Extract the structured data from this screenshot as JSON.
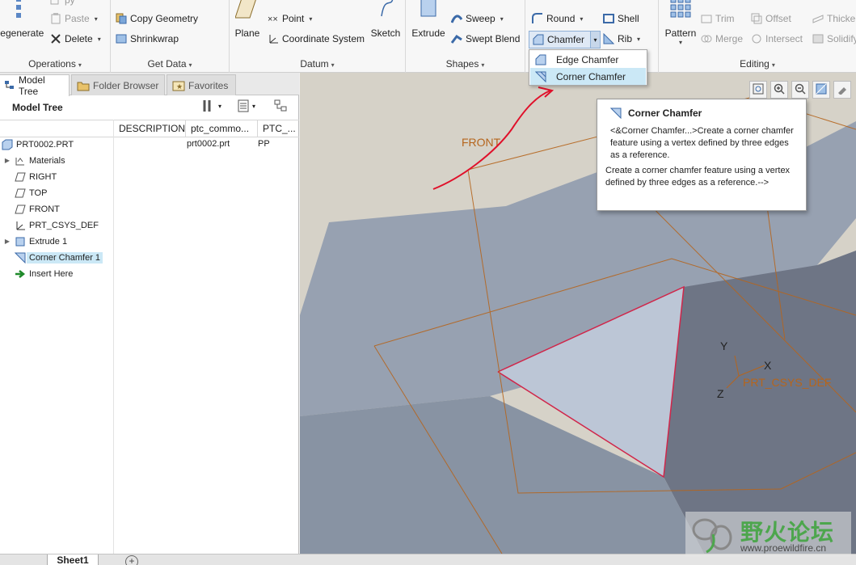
{
  "ribbon": {
    "operations": {
      "regenerate": "Regenerate",
      "copy_partial": "py",
      "paste": "Paste",
      "delete": "Delete",
      "label": "Operations"
    },
    "get_data": {
      "copy_geometry": "Copy Geometry",
      "shrinkwrap": "Shrinkwrap",
      "label": "Get Data"
    },
    "datum": {
      "plane": "Plane",
      "point": "Point",
      "coordinate_system": "Coordinate System",
      "sketch": "Sketch",
      "label": "Datum"
    },
    "shapes": {
      "extrude": "Extrude",
      "sweep": "Sweep",
      "swept_blend": "Swept Blend",
      "label": "Shapes"
    },
    "engineering": {
      "round": "Round",
      "shell": "Shell",
      "chamfer": "Chamfer",
      "rib": "Rib"
    },
    "editing": {
      "pattern": "Pattern",
      "trim": "Trim",
      "offset": "Offset",
      "thicken": "Thicke",
      "merge": "Merge",
      "intersect": "Intersect",
      "solidify": "Solidify",
      "label": "Editing"
    },
    "dropdown_indicator": "▾"
  },
  "chamfer_menu": {
    "items": [
      {
        "label": "Edge Chamfer"
      },
      {
        "label": "Corner Chamfer"
      }
    ]
  },
  "left_panel": {
    "tabs": [
      {
        "label": "Model Tree"
      },
      {
        "label": "Folder Browser"
      },
      {
        "label": "Favorites"
      }
    ],
    "title": "Model Tree",
    "columns": [
      "DESCRIPTION",
      "ptc_commo...",
      "PTC_..."
    ],
    "tree": [
      {
        "label": "PRT0002.PRT",
        "col2": "prt0002.prt",
        "col3": "PP"
      },
      {
        "label": "Materials"
      },
      {
        "label": "RIGHT"
      },
      {
        "label": "TOP"
      },
      {
        "label": "FRONT"
      },
      {
        "label": "PRT_CSYS_DEF"
      },
      {
        "label": "Extrude 1"
      },
      {
        "label": "Corner Chamfer 1"
      },
      {
        "label": "Insert Here"
      }
    ]
  },
  "viewport": {
    "labels": {
      "front": "FRONT",
      "y": "Y",
      "x": "X",
      "z": "Z",
      "csys": "PRT_CSYS_DEF"
    }
  },
  "tooltip": {
    "title": "Corner Chamfer",
    "p1": "<&Corner Chamfer...>Create a corner chamfer feature using a vertex defined by three edges as a reference.",
    "p2": "Create a corner chamfer feature using a vertex defined by three edges as a reference.-->"
  },
  "bottom": {
    "sheet": "Sheet1",
    "add": "+"
  },
  "watermark": {
    "text": "野火论坛",
    "url": "www.proewildfire.cn"
  },
  "colors": {
    "accent": "#cbe8f6",
    "edge_red": "#d0264a",
    "datum_orange": "#b5651d"
  }
}
